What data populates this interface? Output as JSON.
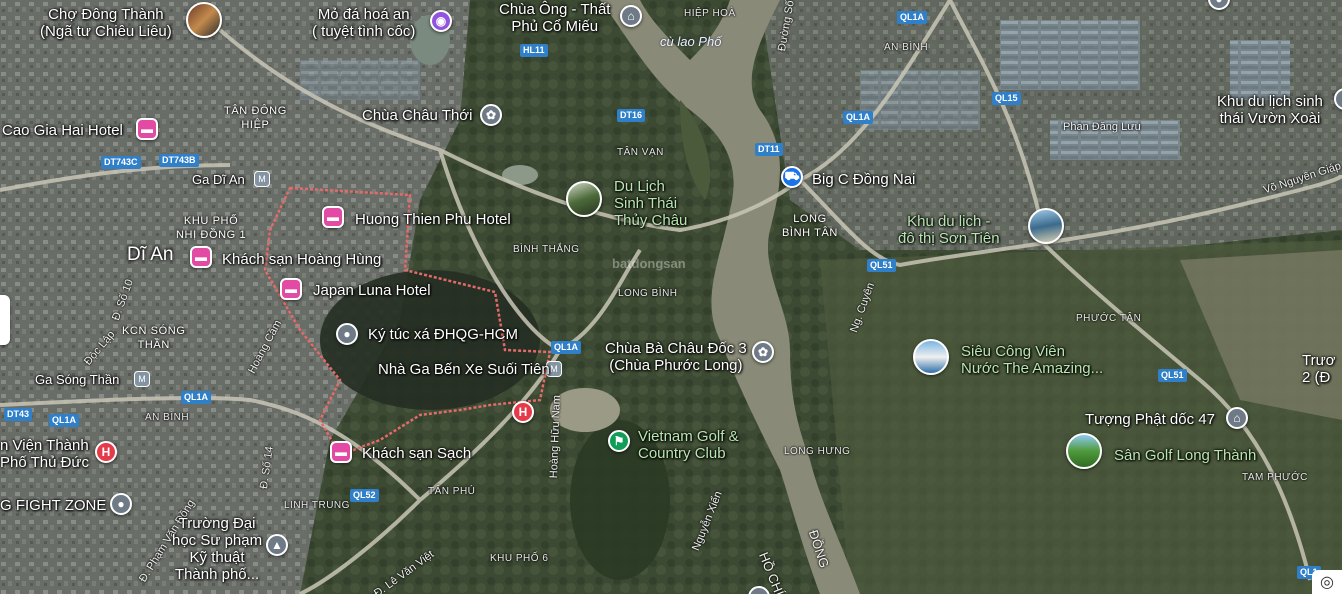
{
  "places": [
    {
      "id": "cho-dong-thanh",
      "lines": [
        "Chợ Đông Thành",
        "(Ngã tư Chiêu Liêu)"
      ]
    },
    {
      "id": "mo-da",
      "lines": [
        "Mỏ đá hoá an",
        "( tuyệt tình cốc)"
      ]
    },
    {
      "id": "chua-ong",
      "lines": [
        "Chùa Ông - Thất",
        "Phủ Cổ Miếu"
      ]
    },
    {
      "id": "chua-chau-thoi",
      "lines": [
        "Chùa Châu Thới"
      ]
    },
    {
      "id": "cao-gia-hai",
      "lines": [
        "Cao Gia Hai Hotel"
      ]
    },
    {
      "id": "huong-thien-phu",
      "lines": [
        "Huong Thien Phu Hotel"
      ]
    },
    {
      "id": "khach-san-hoang-hung",
      "lines": [
        "Khách sạn Hoàng Hùng"
      ]
    },
    {
      "id": "japan-luna",
      "lines": [
        "Japan Luna Hotel"
      ]
    },
    {
      "id": "ktx",
      "lines": [
        "Ký túc xá ĐHQG-HCM"
      ]
    },
    {
      "id": "nha-ga",
      "lines": [
        "Nhà Ga Bến Xe Suối Tiên"
      ]
    },
    {
      "id": "khach-san-sach",
      "lines": [
        "Khách sạn Sạch"
      ]
    },
    {
      "id": "du-lich-sinh-thai",
      "lines": [
        "Du Lịch",
        "Sinh Thái",
        "Thủy Châu"
      ]
    },
    {
      "id": "big-c",
      "lines": [
        "Big C Đồng Nai"
      ]
    },
    {
      "id": "son-tien",
      "lines": [
        "Khu du lịch -",
        "đô thị Sơn Tiên"
      ]
    },
    {
      "id": "chua-ba-chau-doc",
      "lines": [
        "Chùa Bà Châu Đốc 3",
        "(Chùa Phước Long)"
      ]
    },
    {
      "id": "vietnam-golf",
      "lines": [
        "Vietnam Golf &",
        "Country Club"
      ]
    },
    {
      "id": "sieu-cong-vien",
      "lines": [
        "Siêu Công Viên",
        "Nước The Amazing..."
      ]
    },
    {
      "id": "tuong-phat",
      "lines": [
        "Tượng Phật dốc 47"
      ]
    },
    {
      "id": "san-golf",
      "lines": [
        "Sân Golf Long Thành"
      ]
    },
    {
      "id": "vuon-xoai",
      "lines": [
        "Khu du lịch sinh",
        "thái Vườn Xoài"
      ]
    },
    {
      "id": "vien-thanh",
      "lines": [
        "n Viện Thành",
        "Phố Thủ Đức"
      ]
    },
    {
      "id": "fight-zone",
      "lines": [
        "G FIGHT ZONE"
      ]
    },
    {
      "id": "truong-dai-hoc",
      "lines": [
        "Trường Đại",
        "học Sư phạm",
        "Kỹ thuật",
        "Thành phố..."
      ]
    },
    {
      "id": "ga-di-an",
      "lines": [
        "Ga Dĩ An"
      ]
    },
    {
      "id": "ga-song-than",
      "lines": [
        "Ga Sóng Thần"
      ]
    },
    {
      "id": "truong-right",
      "lines": [
        "Trươ",
        "2 (Đ"
      ]
    }
  ],
  "city": "Dĩ An",
  "areas": {
    "hiep_hoa": "HIỆP HOÀ",
    "an_binh_top": "AN BÌNH",
    "tan_dong_hiep": [
      "TÂN ĐÔNG",
      "HIỆP"
    ],
    "khu_pho_nhi_dong": [
      "KHU PHỐ",
      "NHỊ ĐỒNG 1"
    ],
    "kcn_song_than": [
      "KCN SÓNG",
      "THẦN"
    ],
    "an_binh_left": "AN BÌNH",
    "tan_van": "TÂN VẠN",
    "binh_thang": "BÌNH THẮNG",
    "long_binh": "LONG BÌNH",
    "long_binh_tan": [
      "LONG",
      "BÌNH TÂN"
    ],
    "phuoc_tan": "PHƯỚC TÂN",
    "long_hung": "LONG HƯNG",
    "tam_phuoc": "TAM PHƯỚC",
    "tan_phu": "TÂN PHÚ",
    "linh_trung": "LINH TRUNG",
    "khu_pho_6": "KHU PHỐ 6"
  },
  "roads": {
    "hl11": "HL11",
    "dt16": "DT16",
    "dt11": "DT11",
    "ql1a_a": "QL1A",
    "ql1a_b": "QL1A",
    "ql1a_c": "QL1A",
    "ql1a_d": "QL1A",
    "ql1a_e": "QL1A",
    "ql15": "QL15",
    "ql51": "QL51",
    "ql51_b": "QL51",
    "ql52": "QL52",
    "dt743c": "DT743C",
    "dt743b": "DT743B",
    "dt43": "DT43",
    "ql1": "QL1"
  },
  "road_names": {
    "duong_so_5": "Đường Số 5",
    "phan_dang_luu": "Phan Đăng Lưu",
    "vo_nguyen_giap": "Võ Nguyên Giáp",
    "ng_cuyen": "Ng. Cuyên",
    "hoang_huu_nam": "Hoàng Hữu Nam",
    "nguyen_xien": "Nguyễn Xiển",
    "hoang_cam": "Hoàng Cầm",
    "d_so_10": "Đ. Số 10",
    "doc_lap": "Độc Lập",
    "d_so_14": "Đ. Số 14",
    "pham_van_dong": "Đ. Phạm Văn Đồng",
    "le_van_viet": "Đ. Lê Văn Việt",
    "ho_chi": "HỒ CHÍ",
    "dong": "ĐỒNG"
  },
  "river": "cù lao Phố",
  "watermark": "batdongsan",
  "colors": {
    "hotel": "#e24aa4",
    "hospital": "#e53a4a",
    "shopping": "#1a73e8",
    "golf": "#0f9d58",
    "boundary": "#e56a6a",
    "road_badge": "#2f7fc9"
  }
}
